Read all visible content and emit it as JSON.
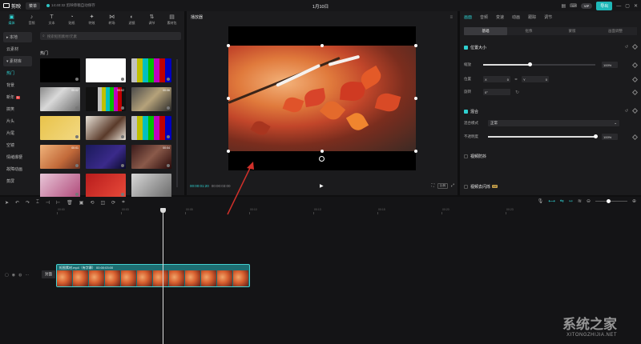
{
  "titlebar": {
    "app_name": "剪映",
    "menu_label": "菜单",
    "autosave": "14:40:32 剪映草稿自动保存",
    "project_title": "1月10日",
    "vip_label": "VIP",
    "export_label": "导出"
  },
  "media_tabs": [
    {
      "label": "媒体",
      "icon": "▣"
    },
    {
      "label": "音频",
      "icon": "♪"
    },
    {
      "label": "文本",
      "icon": "T"
    },
    {
      "label": "贴纸",
      "icon": "◔"
    },
    {
      "label": "特效",
      "icon": "✦"
    },
    {
      "label": "转场",
      "icon": "⋈"
    },
    {
      "label": "滤镜",
      "icon": "◐"
    },
    {
      "label": "调节",
      "icon": "⇅"
    },
    {
      "label": "素材包",
      "icon": "▤"
    }
  ],
  "sidebar": {
    "items": [
      {
        "label": "▸ 本地"
      },
      {
        "label": "云素材"
      },
      {
        "label": "▾ 素材库"
      },
      {
        "label": "热门"
      },
      {
        "label": "背景"
      },
      {
        "label": "新年",
        "badge": "N"
      },
      {
        "label": "搞笑"
      },
      {
        "label": "片头"
      },
      {
        "label": "片尾"
      },
      {
        "label": "空镜"
      },
      {
        "label": "情绪爆梗"
      },
      {
        "label": "故障动画"
      },
      {
        "label": "蒸屏"
      }
    ]
  },
  "library": {
    "search_placeholder": "搜索抠图素材/元素",
    "section_title": "热门",
    "thumbs": [
      {
        "bg": "#000000",
        "dur": ""
      },
      {
        "bg": "#ffffff",
        "dur": ""
      },
      {
        "bg": "linear-gradient(90deg,#c0c0c0 14%,#c0c000 14% 28%,#00c0c0 28% 42%,#00c000 42% 56%,#c000c0 56% 70%,#c00000 70% 84%,#0000c0 84%)",
        "dur": ""
      },
      {
        "bg": "linear-gradient(135deg,#8a8a8a,#d9d9d9 40%,#6a6a6a)",
        "dur": "00:02"
      },
      {
        "bg": "linear-gradient(90deg,#111 30%,#c0c0c0 30% 40%,#c0c000 40% 50%,#00c0c0 50% 60%,#00c000 60% 70%,#c000c0 70% 80%,#c00000 80% 90%,#111 90%)",
        "dur": "00:02"
      },
      {
        "bg": "linear-gradient(135deg,#4a4a4a,#b5a27a 50%,#2a2a2a)",
        "dur": "00:06"
      },
      {
        "bg": "linear-gradient(135deg,#e9c34a,#f2d983)",
        "dur": ""
      },
      {
        "bg": "linear-gradient(135deg,#e8e2d8,#5a3a2a 60%,#e8e2d8)",
        "dur": ""
      },
      {
        "bg": "linear-gradient(90deg,#c0c0c0 14%,#c0c000 14% 28%,#00c0c0 28% 42%,#00c000 42% 56%,#c000c0 56% 70%,#c00000 70% 84%,#0000c0 84%)",
        "dur": ""
      },
      {
        "bg": "linear-gradient(135deg,#f0b37a,#c26a3a 60%,#6a3020)",
        "dur": "00:01"
      },
      {
        "bg": "linear-gradient(135deg,#1a1a5a,#3a2a8a 60%,#0a0a2a)",
        "dur": ""
      },
      {
        "bg": "linear-gradient(135deg,#3a1a1a,#8a5a4a 50%,#2a0a0a)",
        "dur": "00:04"
      },
      {
        "bg": "linear-gradient(135deg,#e8c6d8,#b04a7a)",
        "dur": ""
      },
      {
        "bg": "linear-gradient(135deg,#b81c1c,#e84a3a)",
        "dur": ""
      },
      {
        "bg": "linear-gradient(135deg,#d8d8d8,#6a6a6a)",
        "dur": ""
      }
    ]
  },
  "player": {
    "title": "播放器",
    "current_time": "00:00:01:20",
    "total_time": "00:00:03:00",
    "ratio_label": "比例"
  },
  "inspector": {
    "tabs": [
      "画面",
      "音频",
      "变速",
      "动画",
      "跟踪",
      "调节"
    ],
    "sub_tabs": [
      "基础",
      "抠像",
      "蒙版",
      "画面调整"
    ],
    "position_size": "位置大小",
    "scale_label": "缩放",
    "scale_value": "100%",
    "pos_label": "位置",
    "pos_x": "0",
    "pos_y": "0",
    "rotate_label": "旋转",
    "rotate_value": "0°",
    "blend": "混合",
    "blend_mode_label": "混合模式",
    "blend_mode_value": "正常",
    "opacity_label": "不透明度",
    "opacity_value": "100%",
    "stabilize": "视频防抖",
    "denoise": "视频去闪烁",
    "vip": "VIP",
    "scale_fraction": 0.42,
    "opacity_fraction": 1.0
  },
  "timeline": {
    "ticks": [
      "00:00",
      "00:03",
      "00:05",
      "00:10",
      "00:13",
      "00:15",
      "00:20",
      "00:23"
    ],
    "cover_label": "封面",
    "clip_label": "抠图素材.mp4（有字幕）  00:00:03:00"
  },
  "watermark": {
    "brand": "系统之家",
    "url": "XITONGZHIJIA.NET"
  },
  "colors": {
    "accent": "#2fd0d0",
    "export": "#1fb8b8",
    "annotation": "#d0302a"
  }
}
